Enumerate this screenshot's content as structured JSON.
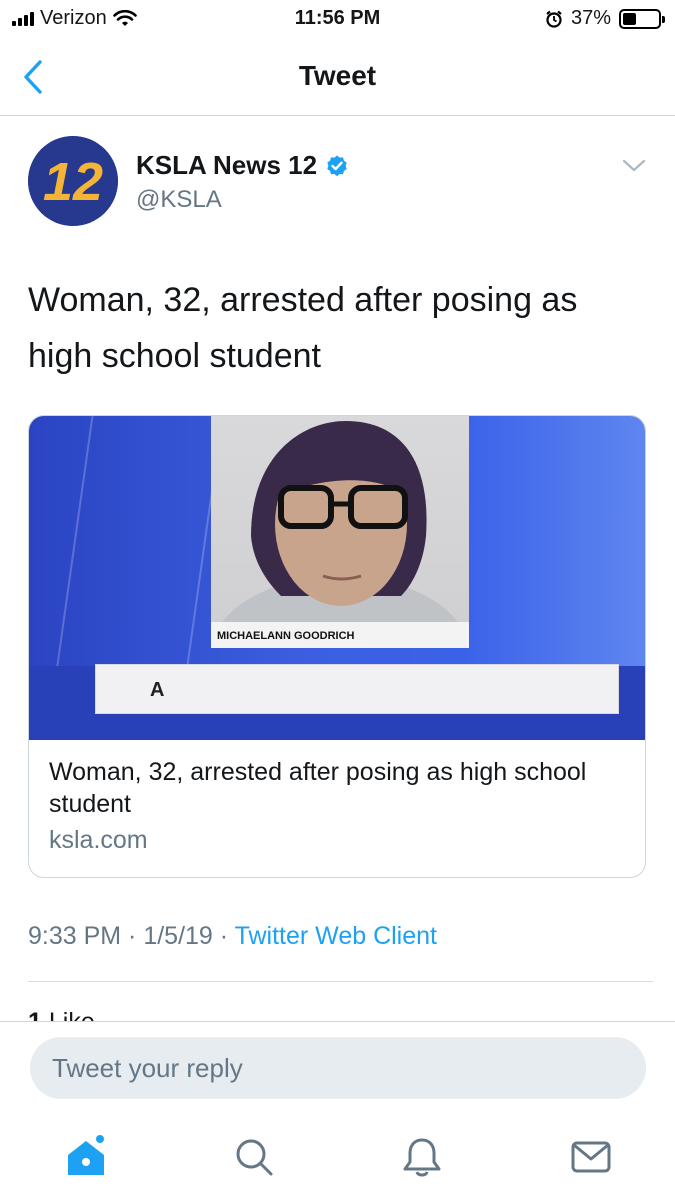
{
  "status_bar": {
    "carrier": "Verizon",
    "time": "11:56 PM",
    "battery": "37%",
    "battery_level": 0.37
  },
  "nav": {
    "title": "Tweet"
  },
  "tweet": {
    "author_name": "KSLA News 12",
    "author_handle": "@KSLA",
    "avatar_text": "12",
    "text": "Woman, 32, arrested after posing as high school student",
    "card": {
      "mugshot_caption": "MICHAELANN GOODRICH",
      "lower_third": "A",
      "title": "Woman, 32, arrested after posing as high school student",
      "domain": "ksla.com"
    },
    "time": "9:33 PM",
    "date": "1/5/19",
    "separator": " · ",
    "client": "Twitter Web Client",
    "likes_count": "1",
    "likes_label": "Like"
  },
  "reply": {
    "placeholder": "Tweet your reply"
  },
  "colors": {
    "accent": "#1da1f2",
    "secondary_text": "#657786",
    "avatar_blue": "#27388f",
    "avatar_gold": "#f4b436"
  },
  "icons": {
    "back": "chevron-left-icon",
    "verified": "verified-badge-icon",
    "caret": "chevron-down-icon",
    "home": "home-icon",
    "search": "search-icon",
    "notifications": "bell-icon",
    "messages": "mail-icon"
  }
}
